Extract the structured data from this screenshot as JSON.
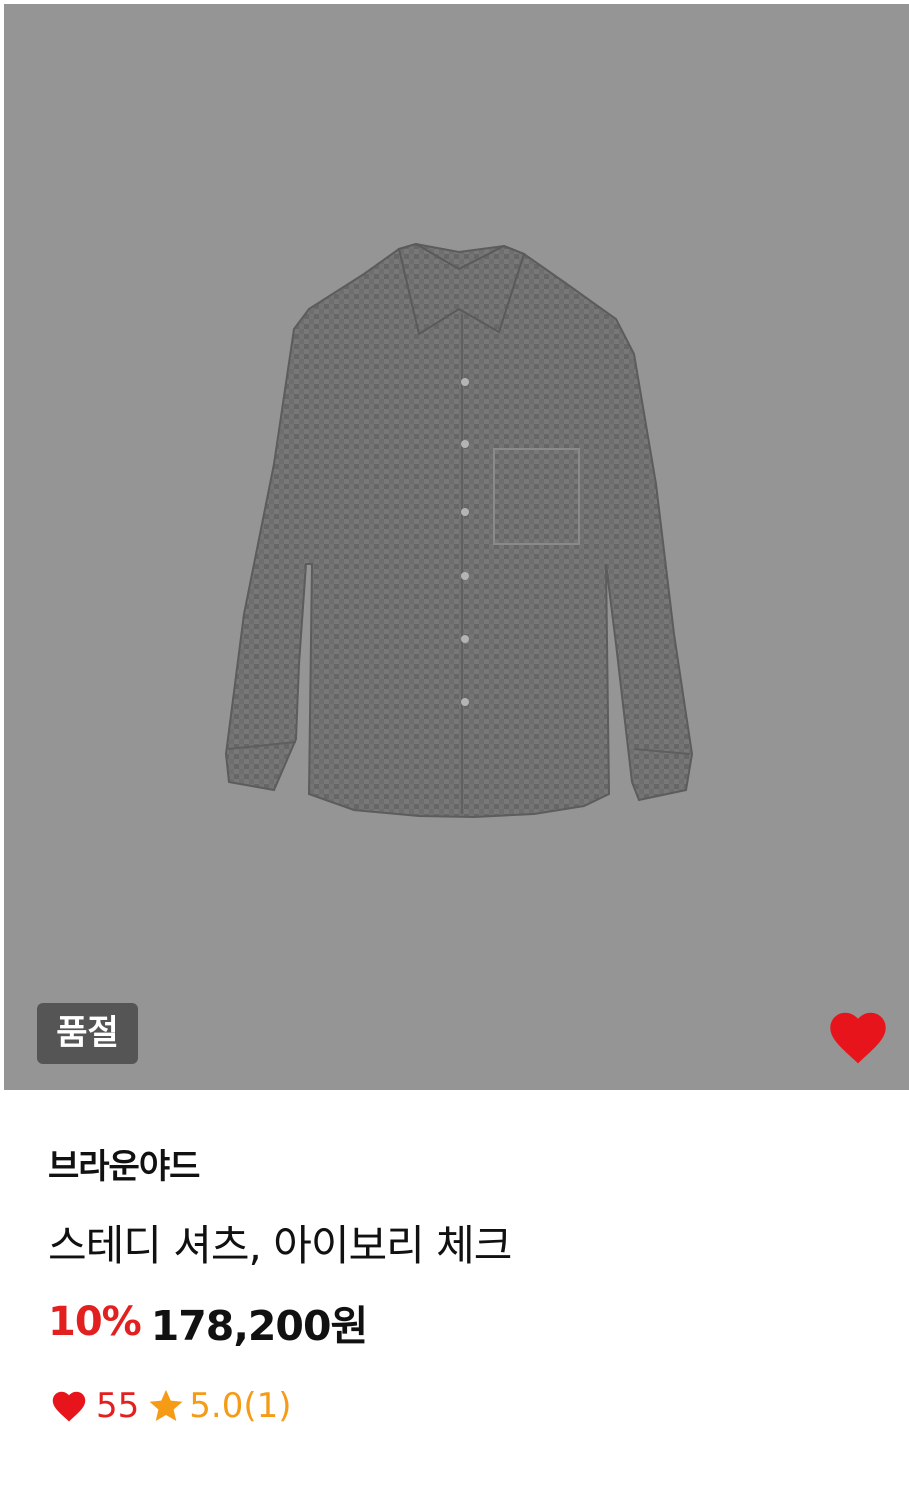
{
  "product": {
    "status_badge": "품절",
    "brand": "브라운야드",
    "name": "스테디 셔츠, 아이보리 체크",
    "discount": "10%",
    "price": "178,200원",
    "likes": "55",
    "rating": "5.0(1)"
  },
  "icons": {
    "wishlist": "heart-icon",
    "likes": "heart-icon",
    "rating": "star-icon"
  },
  "colors": {
    "image_overlay": "#959595",
    "badge_bg": "#555555",
    "accent_red": "#e32020",
    "star_orange": "#f59b16"
  },
  "state": {
    "wishlisted": true,
    "sold_out": true
  }
}
